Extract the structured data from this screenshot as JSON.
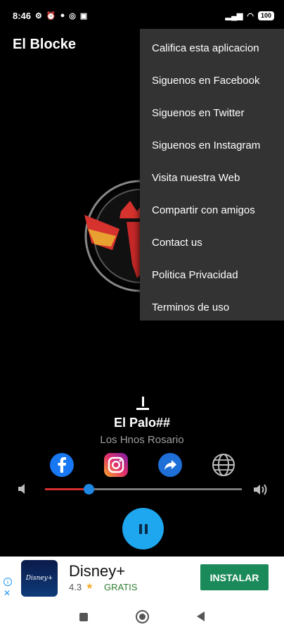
{
  "status_bar": {
    "time": "8:46",
    "battery": "100",
    "left_icons": [
      "settings-icon",
      "alarm-icon",
      "app-icon",
      "whatsapp-icon",
      "u-icon"
    ],
    "right_icons": [
      "signal-icon",
      "wifi-icon",
      "battery-icon"
    ]
  },
  "app": {
    "title": "El Blocke"
  },
  "player": {
    "title": "El Palo##",
    "artist": "Los Hnos Rosario",
    "progress": 0.22,
    "state": "playing"
  },
  "social": [
    "facebook-icon",
    "instagram-icon",
    "share-icon",
    "globe-icon"
  ],
  "menu": {
    "items": [
      "Califica esta aplicacion",
      "Siguenos en Facebook",
      "Siguenos en Twitter",
      "Siguenos en Instagram",
      "Visita nuestra Web",
      "Compartir con amigos",
      "Contact us",
      "Politica Privacidad",
      "Terminos de uso"
    ]
  },
  "ad": {
    "app_name": "Disney+",
    "logo_text": "Disney+",
    "rating": "4.3",
    "price": "GRATIS",
    "install_label": "INSTALAR"
  },
  "colors": {
    "accent": "#1ea7ee",
    "slider_fill": "#d32f2f",
    "menu_bg": "#333333",
    "install_bg": "#1b8a5a"
  }
}
